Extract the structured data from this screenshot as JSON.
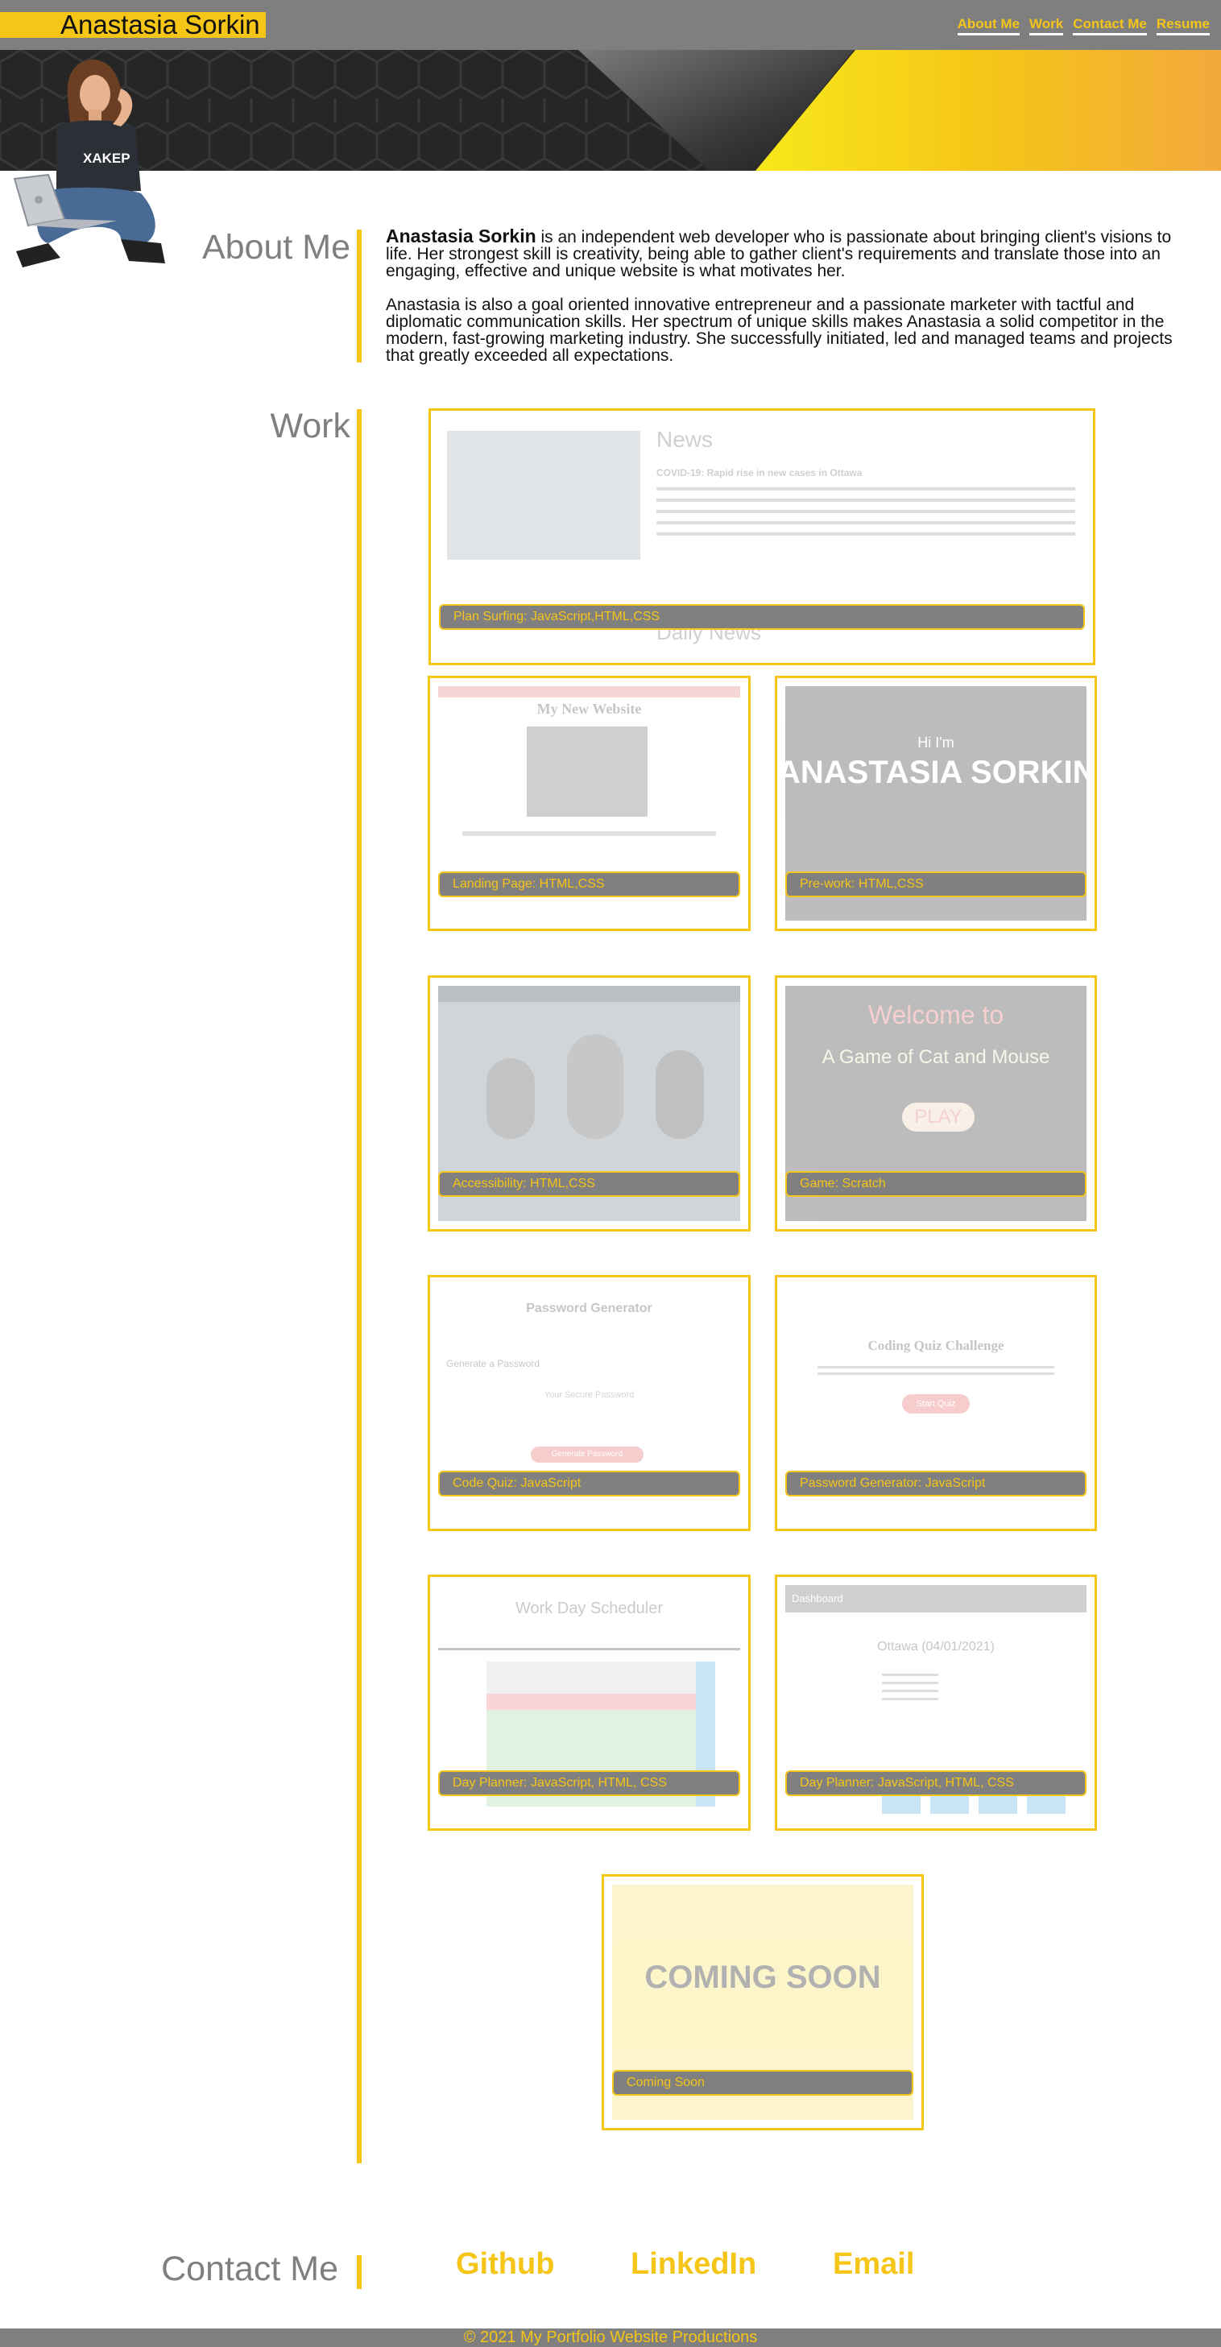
{
  "header": {
    "name": "Anastasia Sorkin",
    "nav": [
      "About Me",
      "Work",
      "Contact Me",
      "Resume"
    ]
  },
  "about": {
    "title": "About Me",
    "name_bold": "Anastasia Sorkin",
    "p1_rest": " is an independent web developer who is passionate about bringing client's visions to life. Her strongest skill is creativity, being able to gather client's requirements and translate those into an engaging, effective and unique website is what motivates her.",
    "p2": "Anastasia is also a goal oriented innovative entrepreneur and a passionate marketer with tactful and diplomatic communication skills. Her spectrum of unique skills makes Anastasia a solid competitor in the modern, fast-growing marketing industry. She successfully initiated, led and managed teams and projects that greatly exceeded all expectations."
  },
  "work": {
    "title": "Work",
    "projects": [
      "Plan Surfing: JavaScript,HTML,CSS",
      "Landing Page: HTML,CSS",
      "Pre-work: HTML,CSS",
      "Accessibility: HTML,CSS",
      "Game: Scratch",
      "Code Quiz: JavaScript",
      "Password Generator: JavaScript",
      "Day Planner: JavaScript, HTML, CSS",
      "Day Planner: JavaScript, HTML, CSS",
      "Coming Soon"
    ],
    "thumb_text": {
      "news_heading": "News",
      "news_headline": "COVID-19: Rapid rise in new cases in Ottawa",
      "news_source": "Daily News",
      "mysite": "My New Website",
      "hi": "Hi I'm",
      "big_name": "ANASTASIA SORKIN",
      "welcome": "Welcome to",
      "game_name": "A Game of Cat and Mouse",
      "play": "PLAY",
      "pw_title": "Password Generator",
      "pw_sub": "Generate a Password",
      "pw_field": "Your Secure Password",
      "pw_btn": "Generate Password",
      "quiz_title": "Coding Quiz Challenge",
      "quiz_btn": "Start Quiz",
      "scheduler": "Work Day Scheduler",
      "dash": "Dashboard",
      "city": "Ottawa (04/01/2021)",
      "soon": "COMING SOON"
    }
  },
  "contact": {
    "title": "Contact Me",
    "links": [
      "Github",
      "LinkedIn",
      "Email"
    ]
  },
  "footer": "© 2021 My Portfolio Website Productions",
  "colors": {
    "accent": "#f5c518",
    "gray": "#7f7f7f"
  }
}
